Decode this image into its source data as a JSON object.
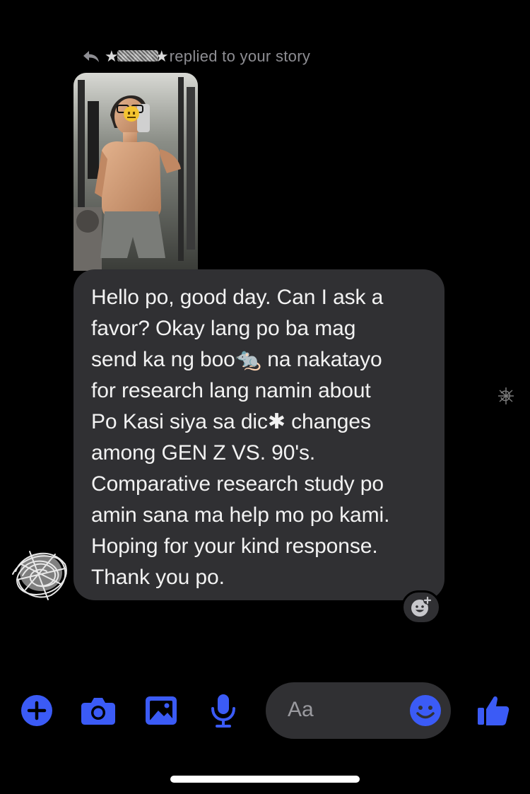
{
  "colors": {
    "background": "#000000",
    "bubble": "#303033",
    "accent": "#3b5bf6",
    "muted_text": "#8e8e93"
  },
  "reply_header": {
    "icon": "reply-arrow-icon",
    "name_redacted": "★★★★★",
    "text": "replied to your story"
  },
  "story": {
    "image": "story-photo-thumbnail"
  },
  "message": {
    "lines": [
      "Hello po, good day. Can I ask a",
      "favor? Okay lang po ba mag",
      "send ka ng boo🐀 na nakatayo",
      "for research lang namin about",
      "Po Kasi siya sa dic✱ changes",
      "among GEN Z VS. 90's.",
      "Comparative research study po",
      "amin sana ma help mo po kami.",
      "Hoping for your kind response.",
      "Thank you po."
    ]
  },
  "reaction_button": {
    "icon": "add-reaction-icon"
  },
  "composer": {
    "buttons": [
      {
        "name": "plus-icon"
      },
      {
        "name": "camera-icon"
      },
      {
        "name": "gallery-icon"
      },
      {
        "name": "microphone-icon"
      }
    ],
    "input_placeholder": "Aa",
    "emoji_icon": "emoji-icon",
    "like_icon": "thumbs-up-icon"
  }
}
